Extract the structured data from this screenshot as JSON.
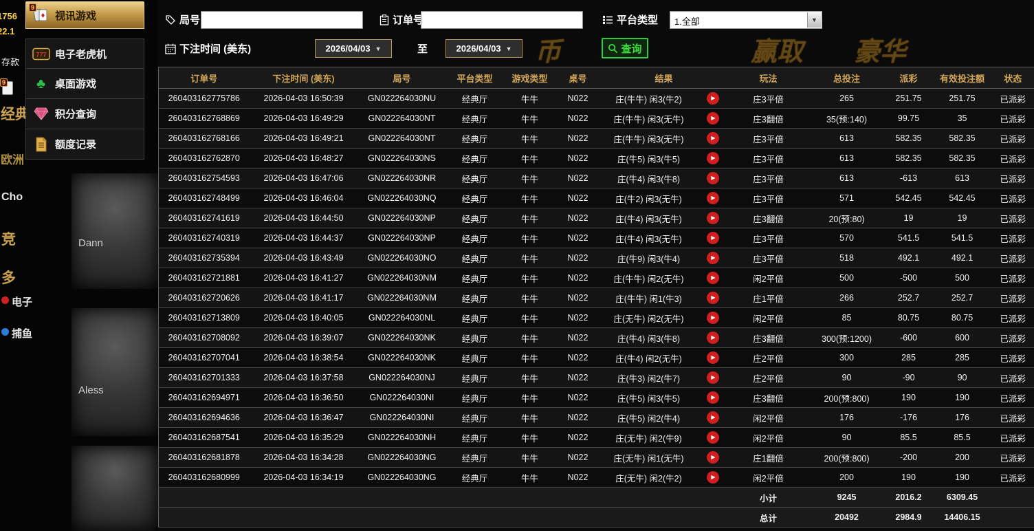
{
  "lobby": {
    "fragments": {
      "balance1": "1756",
      "balance2": "22.1",
      "deposit": "存款",
      "badge": "9",
      "classic": "经典",
      "europe": "欧洲",
      "cho": "Cho",
      "jing": "竞",
      "duo": "多",
      "dianzi": "电子",
      "buyu": "捕鱼",
      "name1": "Dann",
      "name2": "Aless"
    }
  },
  "banner": {
    "frag1": "币",
    "frag2": "赢取",
    "frag3": "豪华"
  },
  "sidebar": {
    "menu": [
      {
        "label": "视讯游戏",
        "badge": "9"
      },
      {
        "label": "电子老虎机",
        "icon_text": "777"
      },
      {
        "label": "桌面游戏"
      },
      {
        "label": "积分查询"
      },
      {
        "label": "额度记录"
      }
    ]
  },
  "filters": {
    "round_label": "局号",
    "round_value": "",
    "order_label": "订单号",
    "order_value": "",
    "platform_label": "平台类型",
    "platform_value": "1.全部",
    "time_label": "下注时间 (美东)",
    "date_from": "2026/04/03",
    "to_label": "至",
    "date_to": "2026/04/03",
    "caret": "▼",
    "search_label": "查询"
  },
  "table": {
    "headers": [
      "订单号",
      "下注时间 (美东)",
      "局号",
      "平台类型",
      "游戏类型",
      "桌号",
      "结果",
      "玩法",
      "总投注",
      "派彩",
      "有效投注额",
      "状态"
    ],
    "rows": [
      {
        "order": "260403162775786",
        "time": "2026-04-03 16:50:39",
        "round": "GN022264030NU",
        "hall": "经典厅",
        "game": "牛牛",
        "tbl": "N022",
        "result": "庄(牛牛) 闲3(牛2)",
        "playtype": "庄3平倍",
        "bet": "265",
        "payout": "251.75",
        "valid": "251.75",
        "status": "已派彩"
      },
      {
        "order": "260403162768869",
        "time": "2026-04-03 16:49:29",
        "round": "GN022264030NT",
        "hall": "经典厅",
        "game": "牛牛",
        "tbl": "N022",
        "result": "庄(牛牛) 闲3(无牛)",
        "playtype": "庄3翻倍",
        "bet": "35(预:140)",
        "payout": "99.75",
        "valid": "35",
        "status": "已派彩"
      },
      {
        "order": "260403162768166",
        "time": "2026-04-03 16:49:21",
        "round": "GN022264030NT",
        "hall": "经典厅",
        "game": "牛牛",
        "tbl": "N022",
        "result": "庄(牛牛) 闲3(无牛)",
        "playtype": "庄3平倍",
        "bet": "613",
        "payout": "582.35",
        "valid": "582.35",
        "status": "已派彩"
      },
      {
        "order": "260403162762870",
        "time": "2026-04-03 16:48:27",
        "round": "GN022264030NS",
        "hall": "经典厅",
        "game": "牛牛",
        "tbl": "N022",
        "result": "庄(牛5) 闲3(牛5)",
        "playtype": "庄3平倍",
        "bet": "613",
        "payout": "582.35",
        "valid": "582.35",
        "status": "已派彩"
      },
      {
        "order": "260403162754593",
        "time": "2026-04-03 16:47:06",
        "round": "GN022264030NR",
        "hall": "经典厅",
        "game": "牛牛",
        "tbl": "N022",
        "result": "庄(牛4) 闲3(牛8)",
        "playtype": "庄3平倍",
        "bet": "613",
        "payout": "-613",
        "valid": "613",
        "status": "已派彩"
      },
      {
        "order": "260403162748499",
        "time": "2026-04-03 16:46:04",
        "round": "GN022264030NQ",
        "hall": "经典厅",
        "game": "牛牛",
        "tbl": "N022",
        "result": "庄(牛2) 闲3(无牛)",
        "playtype": "庄3平倍",
        "bet": "571",
        "payout": "542.45",
        "valid": "542.45",
        "status": "已派彩"
      },
      {
        "order": "260403162741619",
        "time": "2026-04-03 16:44:50",
        "round": "GN022264030NP",
        "hall": "经典厅",
        "game": "牛牛",
        "tbl": "N022",
        "result": "庄(牛4) 闲3(无牛)",
        "playtype": "庄3翻倍",
        "bet": "20(预:80)",
        "payout": "19",
        "valid": "19",
        "status": "已派彩"
      },
      {
        "order": "260403162740319",
        "time": "2026-04-03 16:44:37",
        "round": "GN022264030NP",
        "hall": "经典厅",
        "game": "牛牛",
        "tbl": "N022",
        "result": "庄(牛4) 闲3(无牛)",
        "playtype": "庄3平倍",
        "bet": "570",
        "payout": "541.5",
        "valid": "541.5",
        "status": "已派彩"
      },
      {
        "order": "260403162735394",
        "time": "2026-04-03 16:43:49",
        "round": "GN022264030NO",
        "hall": "经典厅",
        "game": "牛牛",
        "tbl": "N022",
        "result": "庄(牛9) 闲3(牛4)",
        "playtype": "庄3平倍",
        "bet": "518",
        "payout": "492.1",
        "valid": "492.1",
        "status": "已派彩"
      },
      {
        "order": "260403162721881",
        "time": "2026-04-03 16:41:27",
        "round": "GN022264030NM",
        "hall": "经典厅",
        "game": "牛牛",
        "tbl": "N022",
        "result": "庄(牛牛) 闲2(无牛)",
        "playtype": "闲2平倍",
        "bet": "500",
        "payout": "-500",
        "valid": "500",
        "status": "已派彩"
      },
      {
        "order": "260403162720626",
        "time": "2026-04-03 16:41:17",
        "round": "GN022264030NM",
        "hall": "经典厅",
        "game": "牛牛",
        "tbl": "N022",
        "result": "庄(牛牛) 闲1(牛3)",
        "playtype": "庄1平倍",
        "bet": "266",
        "payout": "252.7",
        "valid": "252.7",
        "status": "已派彩"
      },
      {
        "order": "260403162713809",
        "time": "2026-04-03 16:40:05",
        "round": "GN022264030NL",
        "hall": "经典厅",
        "game": "牛牛",
        "tbl": "N022",
        "result": "庄(无牛) 闲2(无牛)",
        "playtype": "闲2平倍",
        "bet": "85",
        "payout": "80.75",
        "valid": "80.75",
        "status": "已派彩"
      },
      {
        "order": "260403162708092",
        "time": "2026-04-03 16:39:07",
        "round": "GN022264030NK",
        "hall": "经典厅",
        "game": "牛牛",
        "tbl": "N022",
        "result": "庄(牛4) 闲3(牛8)",
        "playtype": "庄3翻倍",
        "bet": "300(预:1200)",
        "payout": "-600",
        "valid": "600",
        "status": "已派彩"
      },
      {
        "order": "260403162707041",
        "time": "2026-04-03 16:38:54",
        "round": "GN022264030NK",
        "hall": "经典厅",
        "game": "牛牛",
        "tbl": "N022",
        "result": "庄(牛4) 闲2(无牛)",
        "playtype": "庄2平倍",
        "bet": "300",
        "payout": "285",
        "valid": "285",
        "status": "已派彩"
      },
      {
        "order": "260403162701333",
        "time": "2026-04-03 16:37:58",
        "round": "GN022264030NJ",
        "hall": "经典厅",
        "game": "牛牛",
        "tbl": "N022",
        "result": "庄(牛3) 闲2(牛7)",
        "playtype": "庄2平倍",
        "bet": "90",
        "payout": "-90",
        "valid": "90",
        "status": "已派彩"
      },
      {
        "order": "260403162694971",
        "time": "2026-04-03 16:36:50",
        "round": "GN022264030NI",
        "hall": "经典厅",
        "game": "牛牛",
        "tbl": "N022",
        "result": "庄(牛5) 闲3(牛5)",
        "playtype": "庄3翻倍",
        "bet": "200(预:800)",
        "payout": "190",
        "valid": "190",
        "status": "已派彩"
      },
      {
        "order": "260403162694636",
        "time": "2026-04-03 16:36:47",
        "round": "GN022264030NI",
        "hall": "经典厅",
        "game": "牛牛",
        "tbl": "N022",
        "result": "庄(牛5) 闲2(牛4)",
        "playtype": "闲2平倍",
        "bet": "176",
        "payout": "-176",
        "valid": "176",
        "status": "已派彩"
      },
      {
        "order": "260403162687541",
        "time": "2026-04-03 16:35:29",
        "round": "GN022264030NH",
        "hall": "经典厅",
        "game": "牛牛",
        "tbl": "N022",
        "result": "庄(无牛) 闲2(牛9)",
        "playtype": "闲2平倍",
        "bet": "90",
        "payout": "85.5",
        "valid": "85.5",
        "status": "已派彩"
      },
      {
        "order": "260403162681878",
        "time": "2026-04-03 16:34:28",
        "round": "GN022264030NG",
        "hall": "经典厅",
        "game": "牛牛",
        "tbl": "N022",
        "result": "庄(无牛) 闲1(无牛)",
        "playtype": "庄1翻倍",
        "bet": "200(预:800)",
        "payout": "-200",
        "valid": "200",
        "status": "已派彩"
      },
      {
        "order": "260403162680999",
        "time": "2026-04-03 16:34:19",
        "round": "GN022264030NG",
        "hall": "经典厅",
        "game": "牛牛",
        "tbl": "N022",
        "result": "庄(无牛) 闲2(牛2)",
        "playtype": "闲2平倍",
        "bet": "200",
        "payout": "190",
        "valid": "190",
        "status": "已派彩"
      }
    ],
    "subtotal": {
      "label": "小计",
      "bet": "9245",
      "payout": "2016.2",
      "valid": "6309.45"
    },
    "total": {
      "label": "总计",
      "bet": "20492",
      "payout": "2984.9",
      "valid": "14406.15"
    }
  }
}
